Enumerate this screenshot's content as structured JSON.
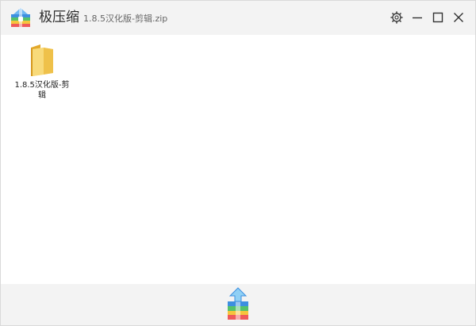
{
  "window": {
    "app_name": "极压缩",
    "file_name": "1.8.5汉化版-剪辑.zip"
  },
  "controls": {
    "settings_icon": "gear-icon",
    "minimize_icon": "minimize-icon",
    "maximize_icon": "maximize-icon",
    "close_icon": "close-icon"
  },
  "files": [
    {
      "name": "1.8.5汉化版-剪辑",
      "type": "folder",
      "icon": "folder-icon"
    }
  ],
  "bottom": {
    "extract_icon": "extract-icon"
  },
  "colors": {
    "titlebar_bg": "#f3f3f3",
    "content_bg": "#ffffff",
    "folder_yellow": "#f5cd5a",
    "logo_blue": "#3d8fe0",
    "logo_green": "#55c26a",
    "logo_yellow": "#f6c43c",
    "logo_red": "#ef5a5a"
  }
}
